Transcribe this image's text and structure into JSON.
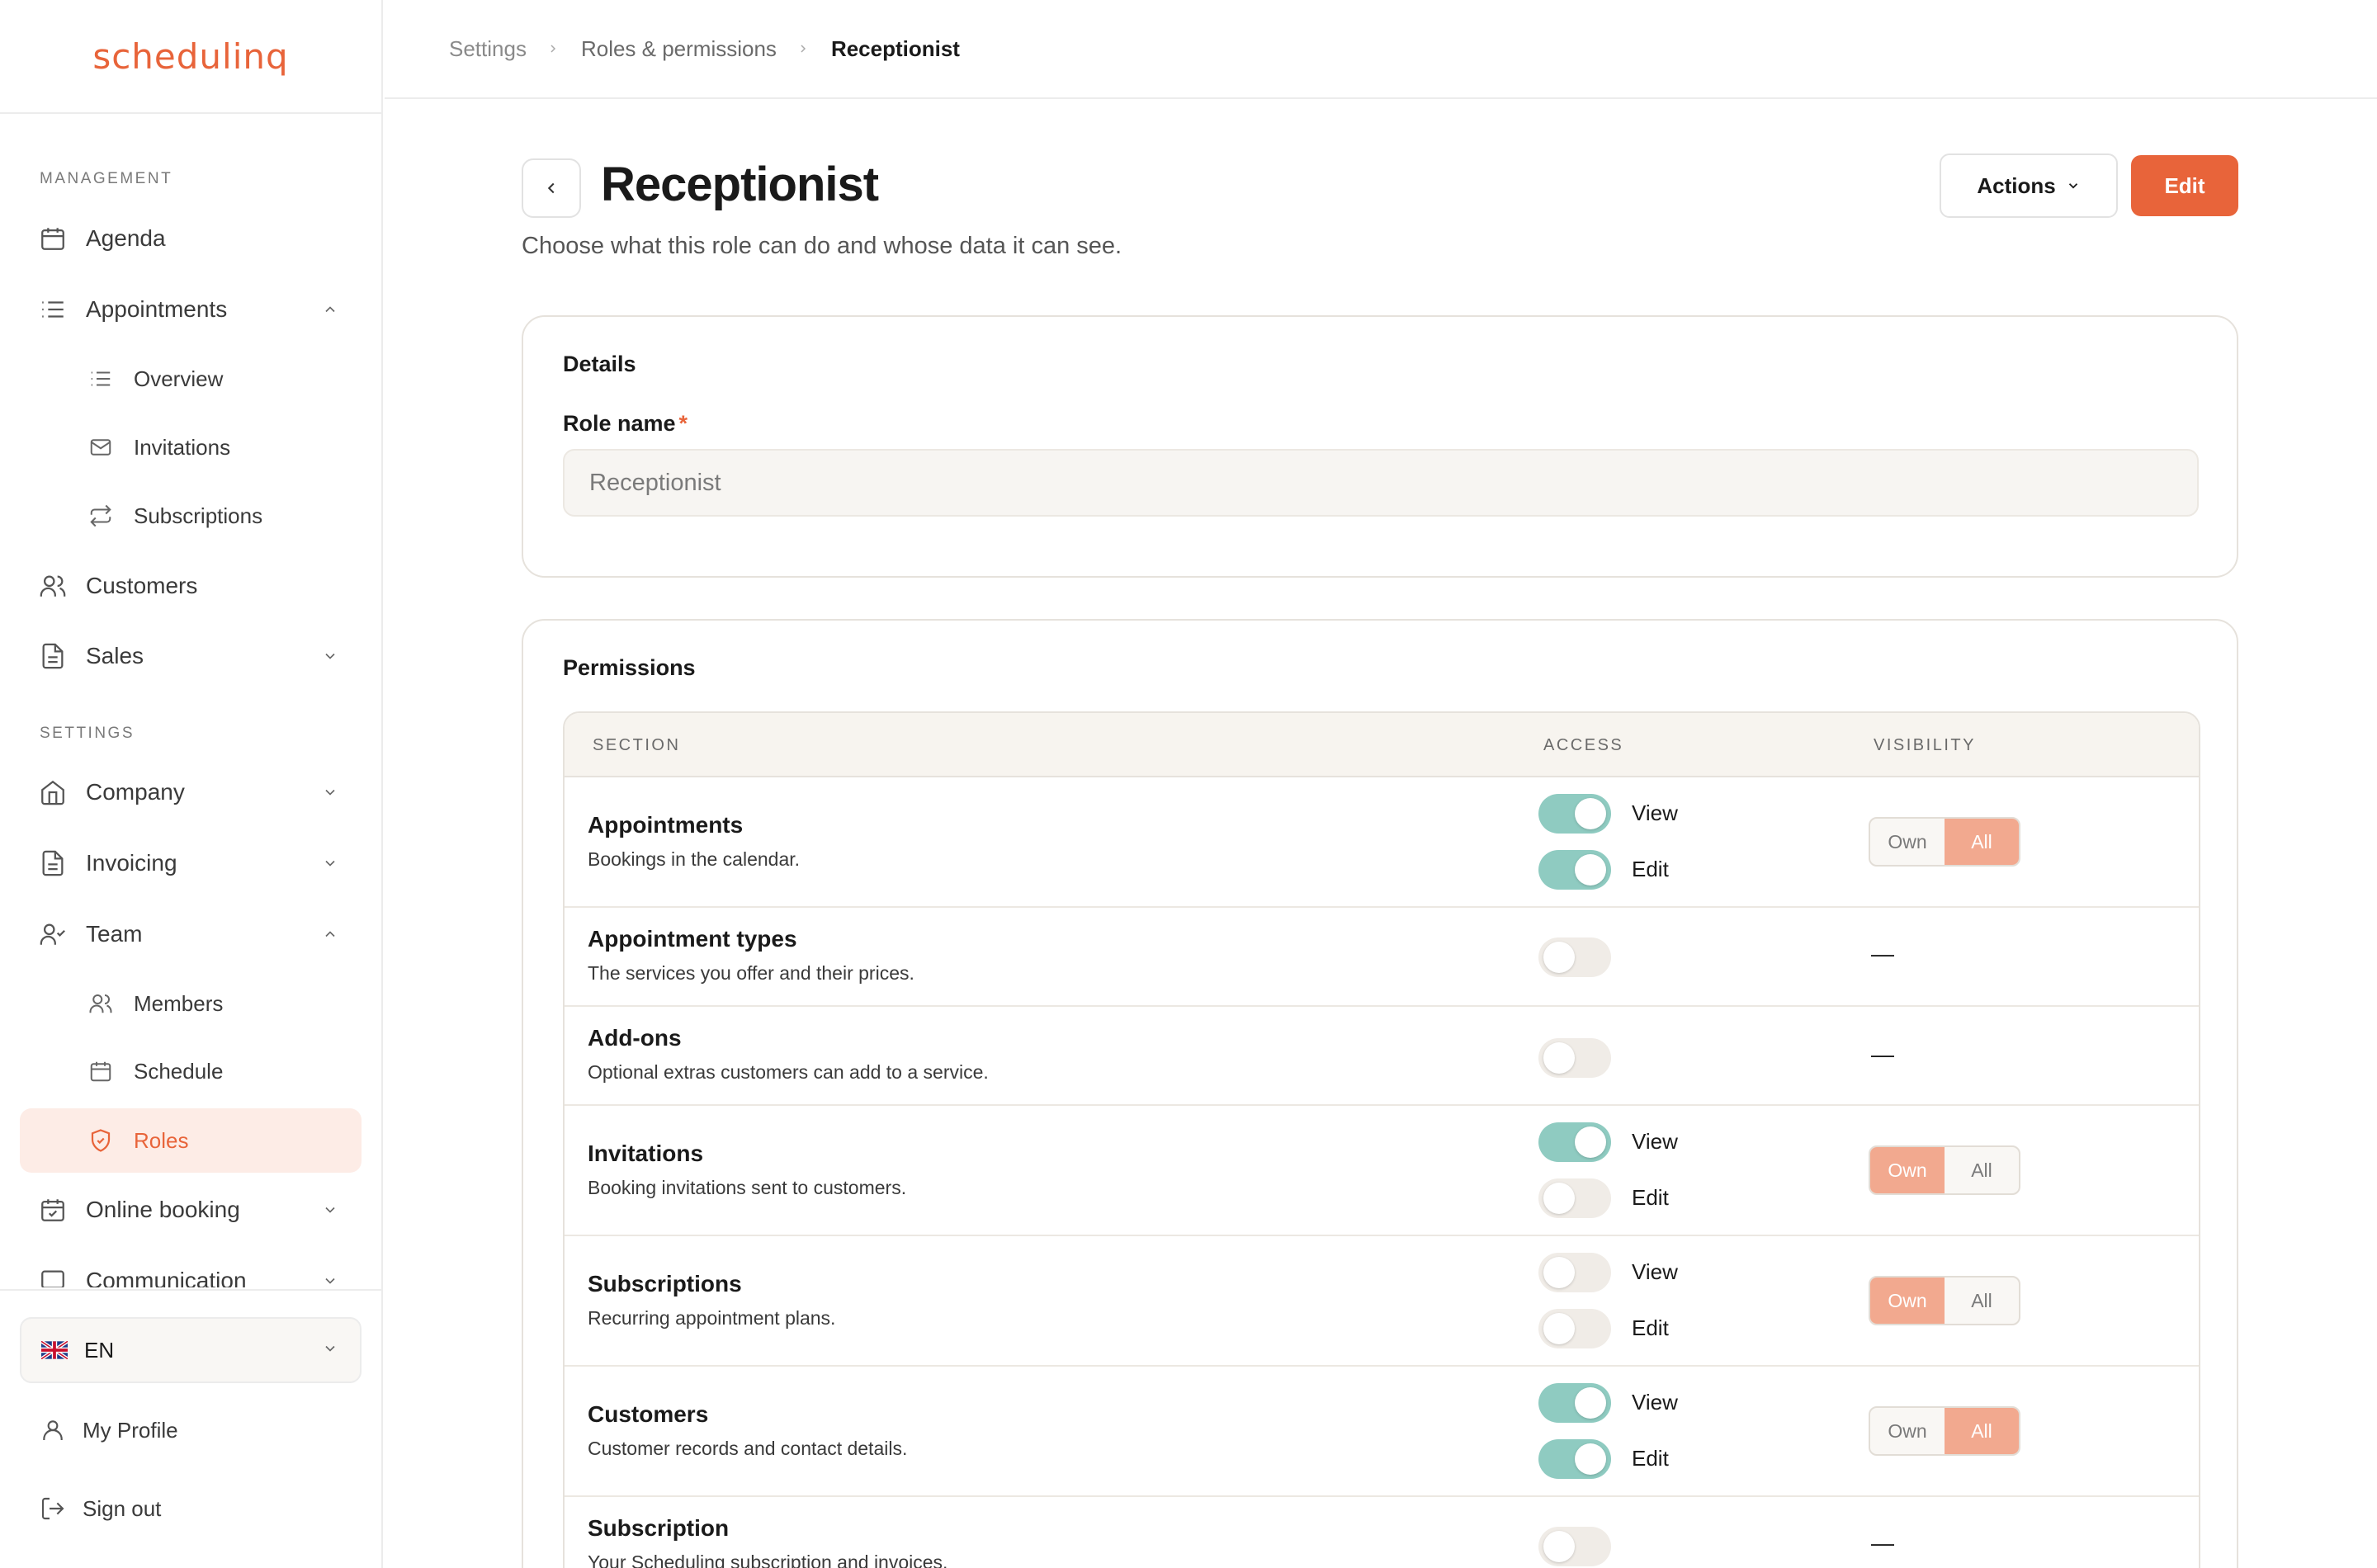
{
  "brand": {
    "logo_text": "schedulinq",
    "accent": "#e8643a"
  },
  "sidebar": {
    "management_label": "MANAGEMENT",
    "settings_label": "SETTINGS",
    "items": [
      {
        "label": "Agenda",
        "icon": "calendar-icon"
      },
      {
        "label": "Appointments",
        "icon": "list-icon",
        "expanded": true
      },
      {
        "label": "Overview",
        "icon": "list-icon"
      },
      {
        "label": "Invitations",
        "icon": "mail-icon"
      },
      {
        "label": "Subscriptions",
        "icon": "repeat-icon"
      },
      {
        "label": "Customers",
        "icon": "users-icon"
      },
      {
        "label": "Sales",
        "icon": "document-icon",
        "expanded": false
      },
      {
        "label": "Company",
        "icon": "home-icon",
        "expanded": false
      },
      {
        "label": "Invoicing",
        "icon": "document-icon",
        "expanded": false
      },
      {
        "label": "Team",
        "icon": "user-check-icon",
        "expanded": true
      },
      {
        "label": "Members",
        "icon": "users-icon"
      },
      {
        "label": "Schedule",
        "icon": "calendar-icon"
      },
      {
        "label": "Roles",
        "icon": "shield-icon",
        "active": true
      },
      {
        "label": "Online booking",
        "icon": "calendar-check-icon",
        "expanded": false
      },
      {
        "label": "Communication",
        "icon": "message-icon",
        "expanded": false
      }
    ],
    "language": {
      "label": "EN",
      "icon": "uk-flag-icon"
    },
    "my_profile": "My Profile",
    "sign_out": "Sign out"
  },
  "breadcrumb": [
    "Settings",
    "Roles & permissions",
    "Receptionist"
  ],
  "page": {
    "title": "Receptionist",
    "subtitle": "Choose what this role can do and whose data it can see.",
    "actions_label": "Actions",
    "edit_label": "Edit"
  },
  "details": {
    "title": "Details",
    "role_name_label": "Role name",
    "required_mark": "*",
    "role_name_value": "Receptionist"
  },
  "permissions": {
    "title": "Permissions",
    "columns": [
      "SECTION",
      "ACCESS",
      "VISIBILITY"
    ],
    "view_label": "View",
    "edit_label": "Edit",
    "own_label": "Own",
    "all_label": "All",
    "dash": "—",
    "rows": [
      {
        "name": "Appointments",
        "desc": "Bookings in the calendar.",
        "view": true,
        "edit": true,
        "visibility": "All"
      },
      {
        "name": "Appointment types",
        "desc": "The services you offer and their prices.",
        "enabled": false
      },
      {
        "name": "Add-ons",
        "desc": "Optional extras customers can add to a service.",
        "enabled": false
      },
      {
        "name": "Invitations",
        "desc": "Booking invitations sent to customers.",
        "view": true,
        "edit": false,
        "visibility": "Own"
      },
      {
        "name": "Subscriptions",
        "desc": "Recurring appointment plans.",
        "view": false,
        "edit": false,
        "visibility": "Own"
      },
      {
        "name": "Customers",
        "desc": "Customer records and contact details.",
        "view": true,
        "edit": true,
        "visibility": "All"
      },
      {
        "name": "Subscription",
        "desc": "Your Scheduling subscription and invoices.",
        "enabled": false
      }
    ]
  },
  "colors": {
    "toggle_on": "#8fcbc1",
    "segment_selected": "#f2a98f",
    "active_nav_bg": "#fdece6"
  }
}
